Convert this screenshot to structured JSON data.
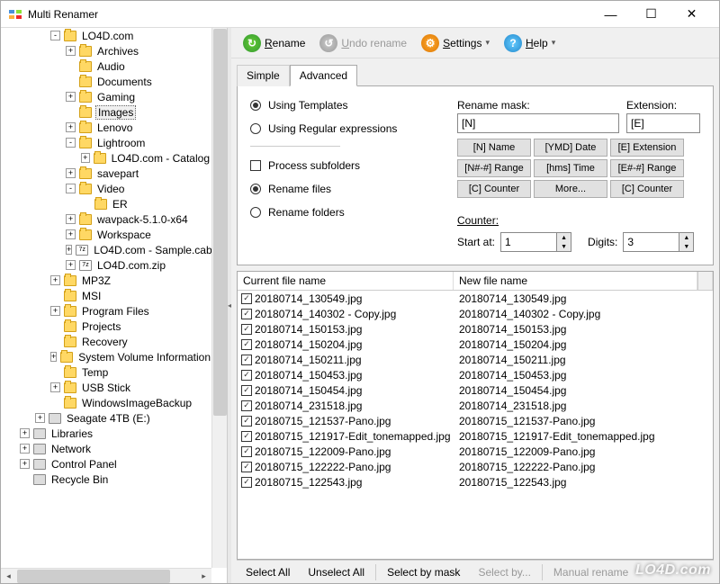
{
  "window": {
    "title": "Multi Renamer"
  },
  "toolbar": {
    "rename": "Rename",
    "undo": "Undo rename",
    "settings": "Settings",
    "help": "Help"
  },
  "tabs": {
    "simple": "Simple",
    "advanced": "Advanced"
  },
  "advanced": {
    "using_templates": "Using Templates",
    "using_regex": "Using Regular expressions",
    "process_subfolders": "Process subfolders",
    "rename_files": "Rename files",
    "rename_folders": "Rename folders",
    "mask_label": "Rename mask:",
    "ext_label": "Extension:",
    "mask_value": "[N]",
    "ext_value": "[E]",
    "buttons": {
      "name": "[N] Name",
      "date": "[YMD] Date",
      "ext": "[E] Extension",
      "rangeN": "[N#-#] Range",
      "time": "[hms] Time",
      "rangeE": "[E#-#] Range",
      "counter": "[C] Counter",
      "more": "More...",
      "counterE": "[C] Counter"
    },
    "counter_label": "Counter:",
    "start_label": "Start at:",
    "start_value": "1",
    "digits_label": "Digits:",
    "digits_value": "3"
  },
  "filelist": {
    "col1": "Current file name",
    "col2": "New file name",
    "rows": [
      {
        "cur": "20180714_130549.jpg",
        "new": "20180714_130549.jpg"
      },
      {
        "cur": "20180714_140302 - Copy.jpg",
        "new": "20180714_140302 - Copy.jpg"
      },
      {
        "cur": "20180714_150153.jpg",
        "new": "20180714_150153.jpg"
      },
      {
        "cur": "20180714_150204.jpg",
        "new": "20180714_150204.jpg"
      },
      {
        "cur": "20180714_150211.jpg",
        "new": "20180714_150211.jpg"
      },
      {
        "cur": "20180714_150453.jpg",
        "new": "20180714_150453.jpg"
      },
      {
        "cur": "20180714_150454.jpg",
        "new": "20180714_150454.jpg"
      },
      {
        "cur": "20180714_231518.jpg",
        "new": "20180714_231518.jpg"
      },
      {
        "cur": "20180715_121537-Pano.jpg",
        "new": "20180715_121537-Pano.jpg"
      },
      {
        "cur": "20180715_121917-Edit_tonemapped.jpg",
        "new": "20180715_121917-Edit_tonemapped.jpg"
      },
      {
        "cur": "20180715_122009-Pano.jpg",
        "new": "20180715_122009-Pano.jpg"
      },
      {
        "cur": "20180715_122222-Pano.jpg",
        "new": "20180715_122222-Pano.jpg"
      },
      {
        "cur": "20180715_122543.jpg",
        "new": "20180715_122543.jpg"
      }
    ]
  },
  "bottombar": {
    "select_all": "Select All",
    "unselect_all": "Unselect All",
    "select_by_mask": "Select by mask",
    "select_by": "Select by...",
    "manual_rename": "Manual rename"
  },
  "tree": {
    "items": [
      {
        "depth": 3,
        "exp": "-",
        "icon": "folder",
        "label": "LO4D.com"
      },
      {
        "depth": 4,
        "exp": "+",
        "icon": "folder",
        "label": "Archives"
      },
      {
        "depth": 4,
        "exp": "",
        "icon": "folder",
        "label": "Audio"
      },
      {
        "depth": 4,
        "exp": "",
        "icon": "folder",
        "label": "Documents"
      },
      {
        "depth": 4,
        "exp": "+",
        "icon": "folder",
        "label": "Gaming"
      },
      {
        "depth": 4,
        "exp": "",
        "icon": "folder",
        "label": "Images",
        "selected": true
      },
      {
        "depth": 4,
        "exp": "+",
        "icon": "folder",
        "label": "Lenovo"
      },
      {
        "depth": 4,
        "exp": "-",
        "icon": "folder",
        "label": "Lightroom"
      },
      {
        "depth": 5,
        "exp": "+",
        "icon": "folder",
        "label": "LO4D.com - Catalog"
      },
      {
        "depth": 4,
        "exp": "+",
        "icon": "folder",
        "label": "savepart"
      },
      {
        "depth": 4,
        "exp": "-",
        "icon": "folder",
        "label": "Video"
      },
      {
        "depth": 5,
        "exp": "",
        "icon": "folder",
        "label": "ER"
      },
      {
        "depth": 4,
        "exp": "+",
        "icon": "folder",
        "label": "wavpack-5.1.0-x64"
      },
      {
        "depth": 4,
        "exp": "+",
        "icon": "folder",
        "label": "Workspace"
      },
      {
        "depth": 4,
        "exp": "+",
        "icon": "zip",
        "label": "LO4D.com - Sample.cab"
      },
      {
        "depth": 4,
        "exp": "+",
        "icon": "zip",
        "label": "LO4D.com.zip"
      },
      {
        "depth": 3,
        "exp": "+",
        "icon": "folder",
        "label": "MP3Z"
      },
      {
        "depth": 3,
        "exp": "",
        "icon": "folder",
        "label": "MSI"
      },
      {
        "depth": 3,
        "exp": "+",
        "icon": "folder",
        "label": "Program Files"
      },
      {
        "depth": 3,
        "exp": "",
        "icon": "folder",
        "label": "Projects"
      },
      {
        "depth": 3,
        "exp": "",
        "icon": "folder",
        "label": "Recovery"
      },
      {
        "depth": 3,
        "exp": "+",
        "icon": "folder",
        "label": "System Volume Information"
      },
      {
        "depth": 3,
        "exp": "",
        "icon": "folder",
        "label": "Temp"
      },
      {
        "depth": 3,
        "exp": "+",
        "icon": "folder",
        "label": "USB Stick"
      },
      {
        "depth": 3,
        "exp": "",
        "icon": "folder",
        "label": "WindowsImageBackup"
      },
      {
        "depth": 2,
        "exp": "+",
        "icon": "drive",
        "label": "Seagate 4TB (E:)"
      },
      {
        "depth": 1,
        "exp": "+",
        "icon": "lib",
        "label": "Libraries"
      },
      {
        "depth": 1,
        "exp": "+",
        "icon": "net",
        "label": "Network"
      },
      {
        "depth": 1,
        "exp": "+",
        "icon": "cp",
        "label": "Control Panel"
      },
      {
        "depth": 1,
        "exp": "",
        "icon": "bin",
        "label": "Recycle Bin"
      }
    ]
  },
  "watermark": "LO4D.com"
}
